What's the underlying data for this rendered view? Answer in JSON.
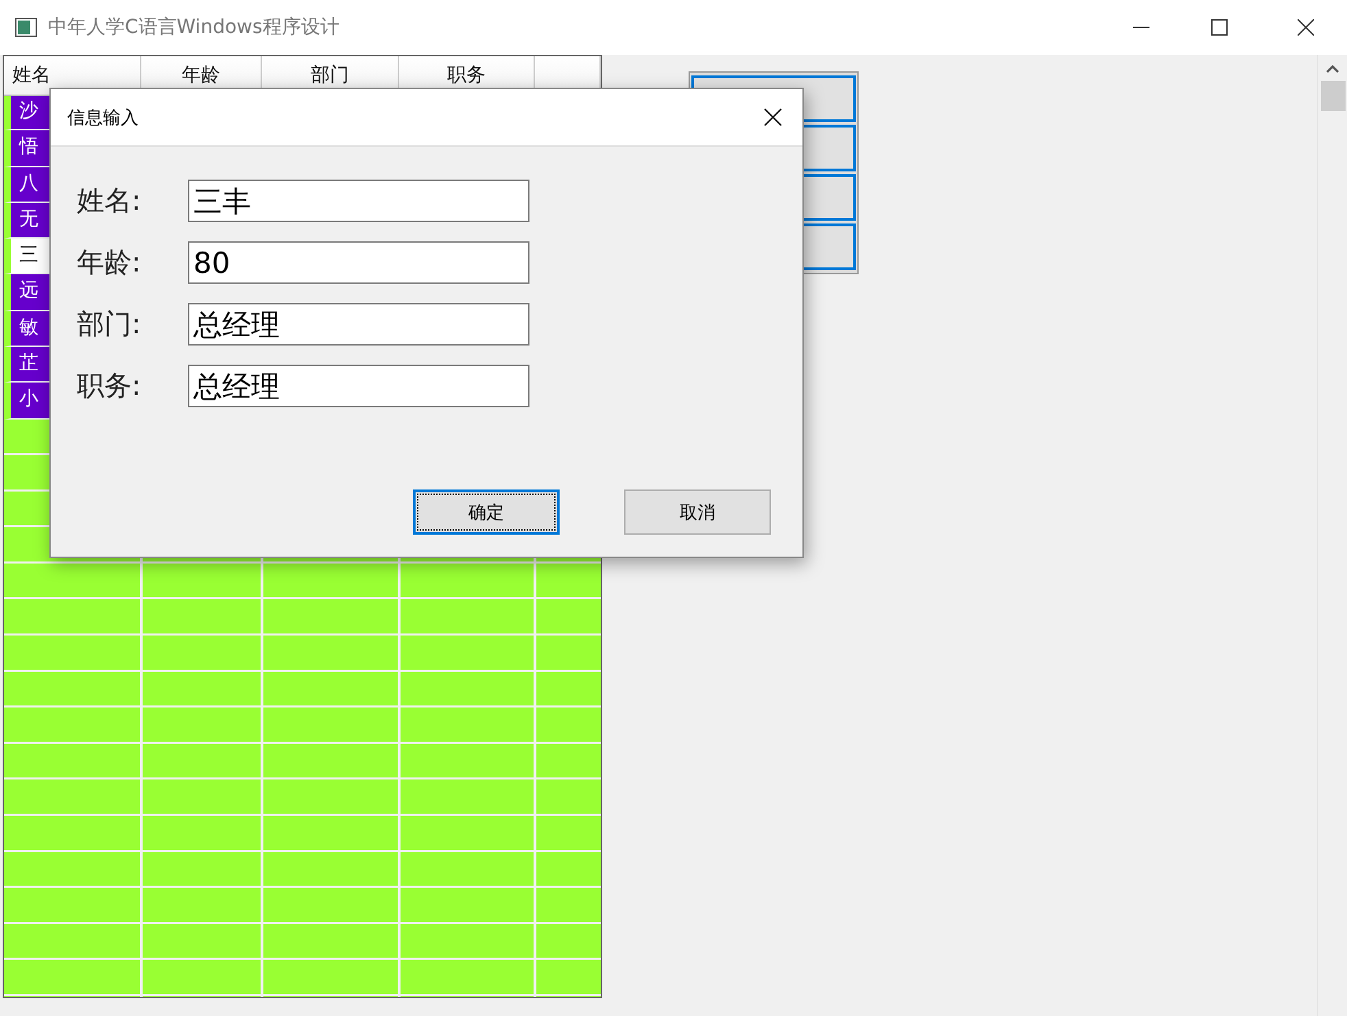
{
  "window": {
    "title": "中年人学C语言Windows程序设计"
  },
  "table": {
    "columns": [
      "姓名",
      "年龄",
      "部门",
      "职务"
    ],
    "rows": [
      {
        "name": "沙",
        "selected": false
      },
      {
        "name": "悟",
        "selected": false
      },
      {
        "name": "八",
        "selected": false
      },
      {
        "name": "无",
        "selected": false
      },
      {
        "name": "三",
        "selected": true
      },
      {
        "name": "远",
        "selected": false
      },
      {
        "name": "敏",
        "selected": false
      },
      {
        "name": "芷",
        "selected": false
      },
      {
        "name": "小",
        "selected": false
      }
    ]
  },
  "side_buttons": [
    {
      "focused": true
    },
    {
      "focused": true
    },
    {
      "focused": true
    },
    {
      "focused": true
    }
  ],
  "dialog": {
    "title": "信息输入",
    "fields": [
      {
        "label": "姓名:",
        "value": "三丰"
      },
      {
        "label": "年龄:",
        "value": "80"
      },
      {
        "label": "部门:",
        "value": "总经理"
      },
      {
        "label": "职务:",
        "value": "总经理"
      }
    ],
    "buttons": [
      {
        "label": "确定",
        "focused": true
      },
      {
        "label": "取消",
        "focused": false
      }
    ]
  }
}
